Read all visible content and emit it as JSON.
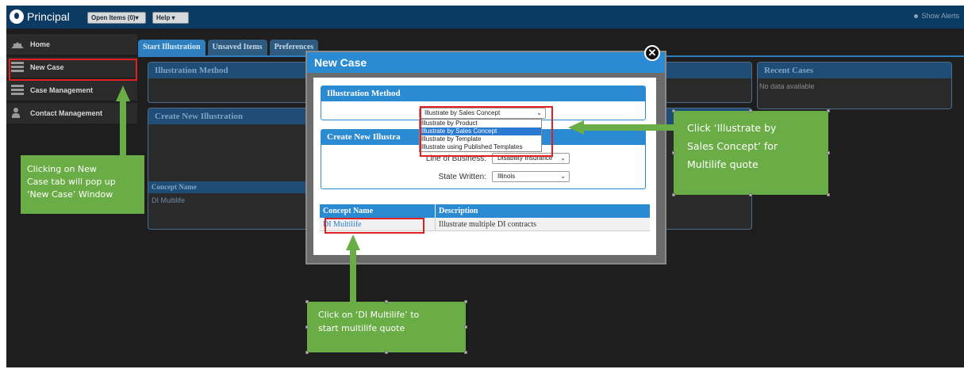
{
  "app": {
    "logo_text": "Principal",
    "open_items_label": "Open Items (0)▾",
    "help_label": "Help ▾",
    "show_alerts_label": "Show Alerts"
  },
  "sidebar": {
    "items": [
      {
        "label": "Home",
        "icon": "home-icon"
      },
      {
        "label": "New Case",
        "icon": "bars-icon"
      },
      {
        "label": "Case Management",
        "icon": "bars-icon"
      },
      {
        "label": "Contact Management",
        "icon": "person-icon"
      }
    ]
  },
  "tabs": [
    "Start Illustration",
    "Unsaved Items",
    "Preferences"
  ],
  "background": {
    "illustration_method_title": "Illustration Method",
    "create_new_title": "Create New Illustration",
    "concept_name_header": "Concept Name",
    "concept_row": "DI Multilife",
    "recent_cases_title": "Recent Cases",
    "recent_cases_empty": "No data available"
  },
  "modal": {
    "title": "New Case",
    "close_label": "✕",
    "illustration_method_title": "Illustration Method",
    "method_selected": "Illustrate by Sales Concept",
    "method_options": [
      "Illustrate by Product",
      "Illustrate by Sales Concept",
      "Illustrate by Template",
      "Illustrate using Published Templates"
    ],
    "create_new_title": "Create New Illustra",
    "lob_label": "Line of Business:",
    "lob_value": "Disability Insurance",
    "state_label": "State Written:",
    "state_value": "Illinois",
    "table": {
      "headers": [
        "Concept Name",
        "Description"
      ],
      "rows": [
        [
          "DI Multilife",
          "Illustrate multiple DI contracts"
        ]
      ]
    }
  },
  "callouts": {
    "new_case": [
      "Clicking on New",
      "Case tab will pop up",
      "‘New Case’ Window"
    ],
    "sales_concept": [
      "Click ‘Illustrate by",
      "Sales Concept’ for",
      "Multilife quote"
    ],
    "di_multilife": [
      "Click on ‘DI Multilife’ to",
      "start multilife quote"
    ]
  },
  "colors": {
    "topbar": "#0b3a62",
    "accent_blue": "#2a8ad2",
    "callout_green": "#6aac46",
    "highlight_red": "#e02020"
  }
}
